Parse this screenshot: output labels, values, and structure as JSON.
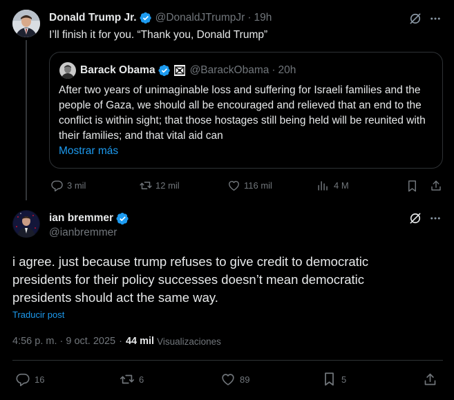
{
  "reply": {
    "name": "Donald Trump Jr.",
    "handle": "@DonaldJTrumpJr",
    "separator": "·",
    "time": "19h",
    "text": "I’ll finish it for you. “Thank you, Donald Trump”",
    "quote": {
      "name": "Barack Obama",
      "handle": "@BarackObama",
      "separator": "·",
      "time": "20h",
      "text": "After two years of unimaginable loss and suffering for Israeli families and the people of Gaza, we should all be encouraged and relieved that an end to the conflict is within sight; that those hostages still being held will be reunited with their families; and that vital aid can",
      "show_more": "Mostrar más"
    },
    "stats": {
      "replies": "3 mil",
      "reposts": "12 mil",
      "likes": "116 mil",
      "views": "4 M"
    }
  },
  "main": {
    "name": "ian bremmer",
    "handle": "@ianbremmer",
    "text": "i agree. just because trump refuses to give credit to democratic presidents for their policy successes doesn’t mean democratic presidents should act the same way.",
    "translate": "Traducir post",
    "timestamp": "4:56 p. m. · 9 oct. 2025",
    "dot": "·",
    "views_count": "44 mil",
    "views_label": "Visualizaciones",
    "stats": {
      "replies": "16",
      "reposts": "6",
      "likes": "89",
      "bookmarks": "5"
    }
  },
  "colors": {
    "background": "#000000",
    "text": "#e7e9ea",
    "secondary": "#71767b",
    "link": "#1d9bf0",
    "verified": "#1d9bf0",
    "border": "#2f3336"
  },
  "icons": [
    "grok-icon",
    "more-icon",
    "reply-icon",
    "repost-icon",
    "like-icon",
    "views-icon",
    "bookmark-icon",
    "share-icon",
    "verified-icon",
    "gaza-flag-icon"
  ]
}
